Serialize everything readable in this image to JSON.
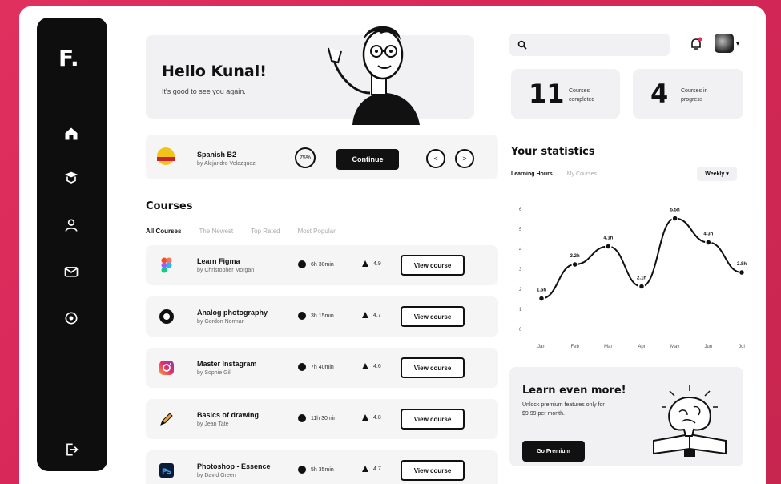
{
  "brand": {
    "logo": "F."
  },
  "greeting": {
    "title": "Hello Kunal!",
    "subtitle": "It's good to see you again."
  },
  "current_course": {
    "title": "Spanish B2",
    "author": "by Alejandro Velazquez",
    "progress": "75%",
    "continue_label": "Continue",
    "prev_label": "<",
    "next_label": ">"
  },
  "courses": {
    "title": "Courses",
    "tabs": [
      "All Courses",
      "The Newest",
      "Top Rated",
      "Most Popular"
    ],
    "items": [
      {
        "title": "Learn Figma",
        "author": "by Christopher Morgan",
        "time": "6h 30min",
        "rating": "4.9",
        "action": "View course",
        "icon": "figma-icon"
      },
      {
        "title": "Analog photography",
        "author": "by Gordon Norman",
        "time": "3h 15min",
        "rating": "4.7",
        "action": "View course",
        "icon": "aperture-icon"
      },
      {
        "title": "Master Instagram",
        "author": "by Sophie Gill",
        "time": "7h 40min",
        "rating": "4.6",
        "action": "View course",
        "icon": "instagram-icon"
      },
      {
        "title": "Basics of drawing",
        "author": "by Jean Tate",
        "time": "11h 30min",
        "rating": "4.8",
        "action": "View course",
        "icon": "pencil-icon"
      },
      {
        "title": "Photoshop - Essence",
        "author": "by David Green",
        "time": "5h 35min",
        "rating": "4.7",
        "action": "View course",
        "icon": "photoshop-icon"
      }
    ]
  },
  "stats": {
    "completed": {
      "value": "11",
      "label": "Courses completed"
    },
    "in_progress": {
      "value": "4",
      "label": "Courses in progress"
    }
  },
  "statistics": {
    "title": "Your statistics",
    "tabs": [
      "Learning Hours",
      "My Courses"
    ],
    "period": "Weekly"
  },
  "chart_data": {
    "type": "line",
    "categories": [
      "Jan",
      "Feb",
      "Mar",
      "Apr",
      "May",
      "Jun",
      "Jul"
    ],
    "values": [
      1.5,
      3.2,
      4.1,
      2.1,
      5.5,
      4.3,
      2.8
    ],
    "data_labels": [
      "1.5h",
      "3.2h",
      "4.1h",
      "2.1h",
      "5.5h",
      "4.3h",
      "2.8h"
    ],
    "ylim": [
      0,
      6
    ],
    "yticks": [
      "6",
      "5",
      "4",
      "3",
      "2",
      "1",
      "0"
    ],
    "grid": false
  },
  "promo": {
    "title": "Learn even more!",
    "text": "Unlock premium features only for $9.99 per month.",
    "button": "Go Premium"
  },
  "colors": {
    "accent": "#111111",
    "background": "#d8285a",
    "panel": "#f1f1f3"
  }
}
